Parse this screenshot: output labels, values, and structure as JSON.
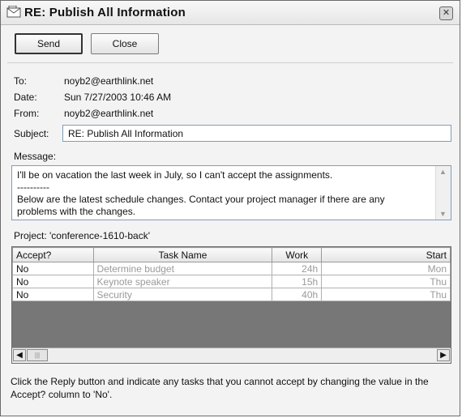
{
  "window": {
    "title": "RE: Publish All Information"
  },
  "toolbar": {
    "send_label": "Send",
    "close_label": "Close"
  },
  "header": {
    "to_label": "To:",
    "to_value": "noyb2@earthlink.net",
    "date_label": "Date:",
    "date_value": "Sun 7/27/2003 10:46 AM",
    "from_label": "From:",
    "from_value": "noyb2@earthlink.net",
    "subject_label": "Subject:",
    "subject_value": "RE: Publish All Information"
  },
  "message": {
    "label": "Message:",
    "lines": [
      "I'll be on vacation the last week in July, so I can't accept the assignments.",
      "----------",
      "Below are the latest schedule changes. Contact your project manager if there are any",
      "problems with the changes."
    ]
  },
  "project": {
    "label": "Project: 'conference-1610-back'"
  },
  "tasks": {
    "columns": [
      "Accept?",
      "Task Name",
      "Work",
      "Start"
    ],
    "rows": [
      [
        "No",
        "Determine budget",
        "24h",
        "Mon"
      ],
      [
        "No",
        "Keynote speaker",
        "15h",
        "Thu"
      ],
      [
        "No",
        "Security",
        "40h",
        "Thu"
      ]
    ]
  },
  "footer": {
    "text": "Click the Reply button and indicate any tasks that you cannot accept by changing the value in the Accept? column to 'No'."
  }
}
